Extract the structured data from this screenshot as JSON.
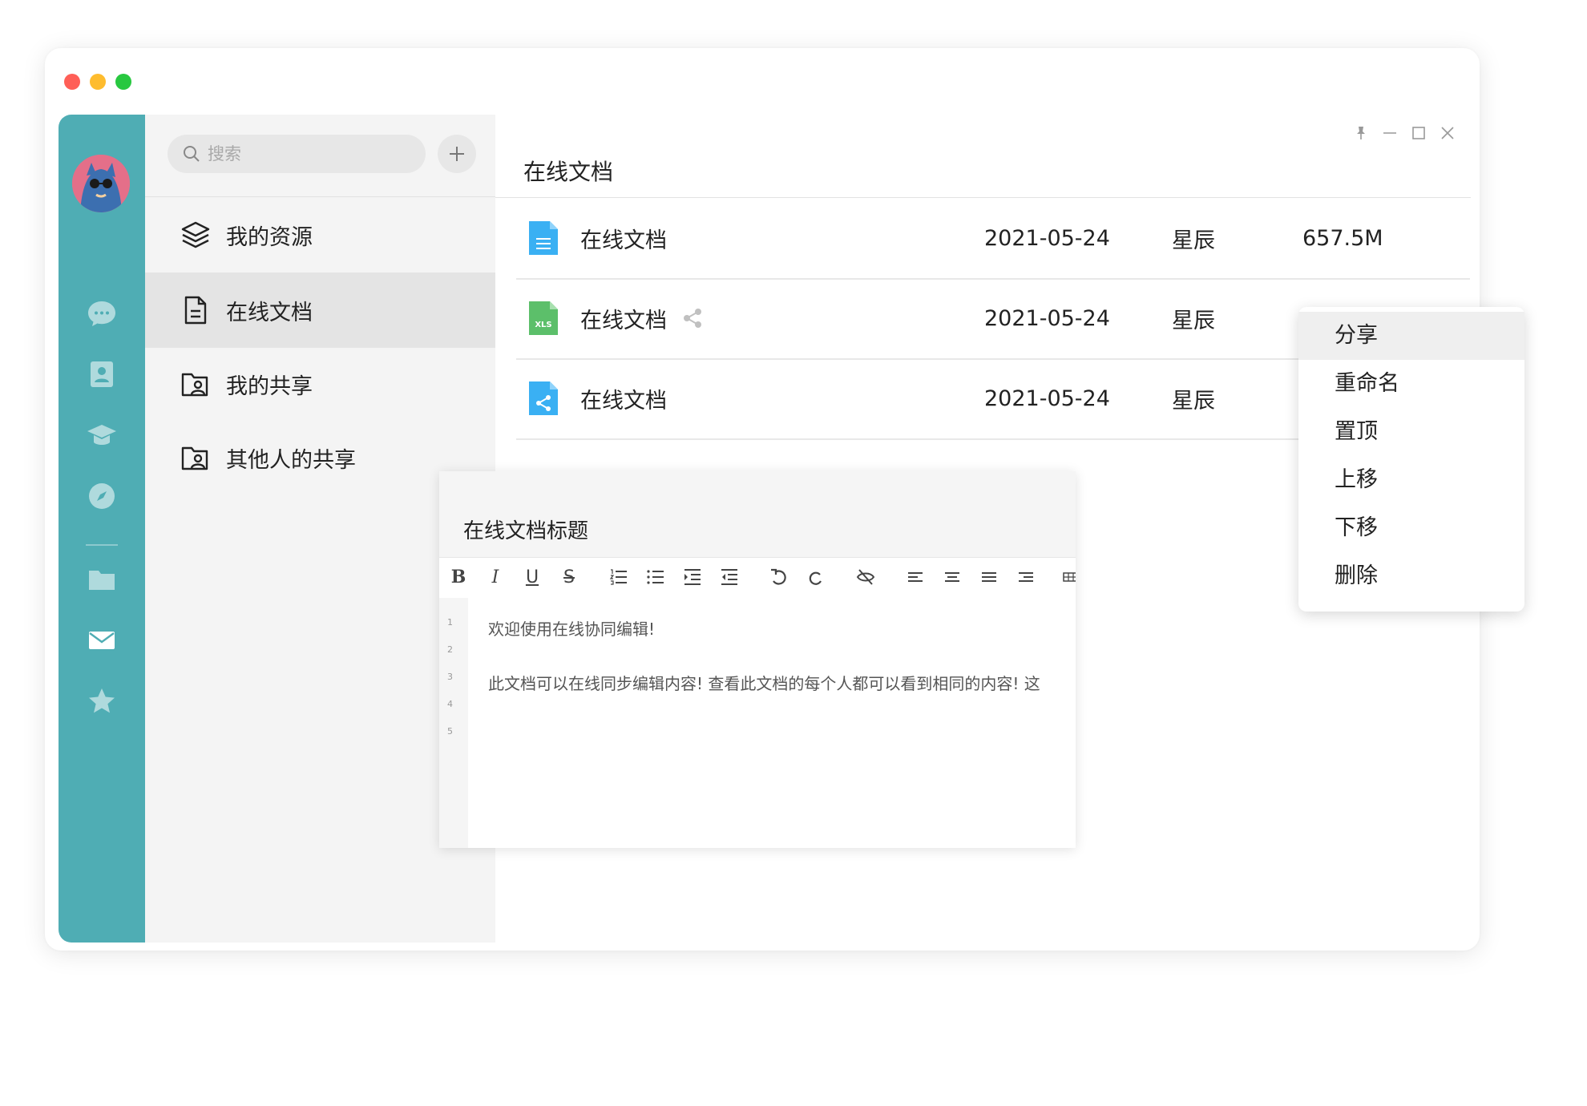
{
  "sidebar": {
    "search_placeholder": "搜索",
    "items": [
      {
        "label": "我的资源",
        "icon": "layers-icon"
      },
      {
        "label": "在线文档",
        "icon": "document-icon",
        "active": true
      },
      {
        "label": "我的共享",
        "icon": "shared-folder-icon"
      },
      {
        "label": "其他人的共享",
        "icon": "shared-folder-icon"
      }
    ]
  },
  "rail": {
    "icons": [
      "chat-icon",
      "contacts-icon",
      "education-icon",
      "compass-icon",
      "folder-icon",
      "mail-icon",
      "star-icon"
    ]
  },
  "main": {
    "title": "在线文档",
    "rows": [
      {
        "name": "在线文档",
        "date": "2021-05-24",
        "owner": "星辰",
        "size": "657.5M",
        "icon": "doc-file-icon"
      },
      {
        "name": "在线文档",
        "date": "2021-05-24",
        "owner": "星辰",
        "size": "",
        "icon": "xls-file-icon",
        "shared": true
      },
      {
        "name": "在线文档",
        "date": "2021-05-24",
        "owner": "星辰",
        "size": "",
        "icon": "shared-file-icon"
      }
    ]
  },
  "context_menu": {
    "items": [
      "分享",
      "重命名",
      "置顶",
      "上移",
      "下移",
      "删除"
    ]
  },
  "editor": {
    "title": "在线文档标题",
    "line_numbers": [
      "1",
      "2",
      "3",
      "4",
      "5"
    ],
    "lines": [
      "欢迎使用在线协同编辑!",
      "此文档可以在线同步编辑内容! 查看此文档的每个人都可以看到相同的内容! 这"
    ],
    "toolbar": [
      "B",
      "I",
      "U",
      "S"
    ]
  },
  "colors": {
    "rail": "#4fadb4",
    "doc_blue": "#3ab0f3",
    "xls_green": "#5cbf6a"
  }
}
